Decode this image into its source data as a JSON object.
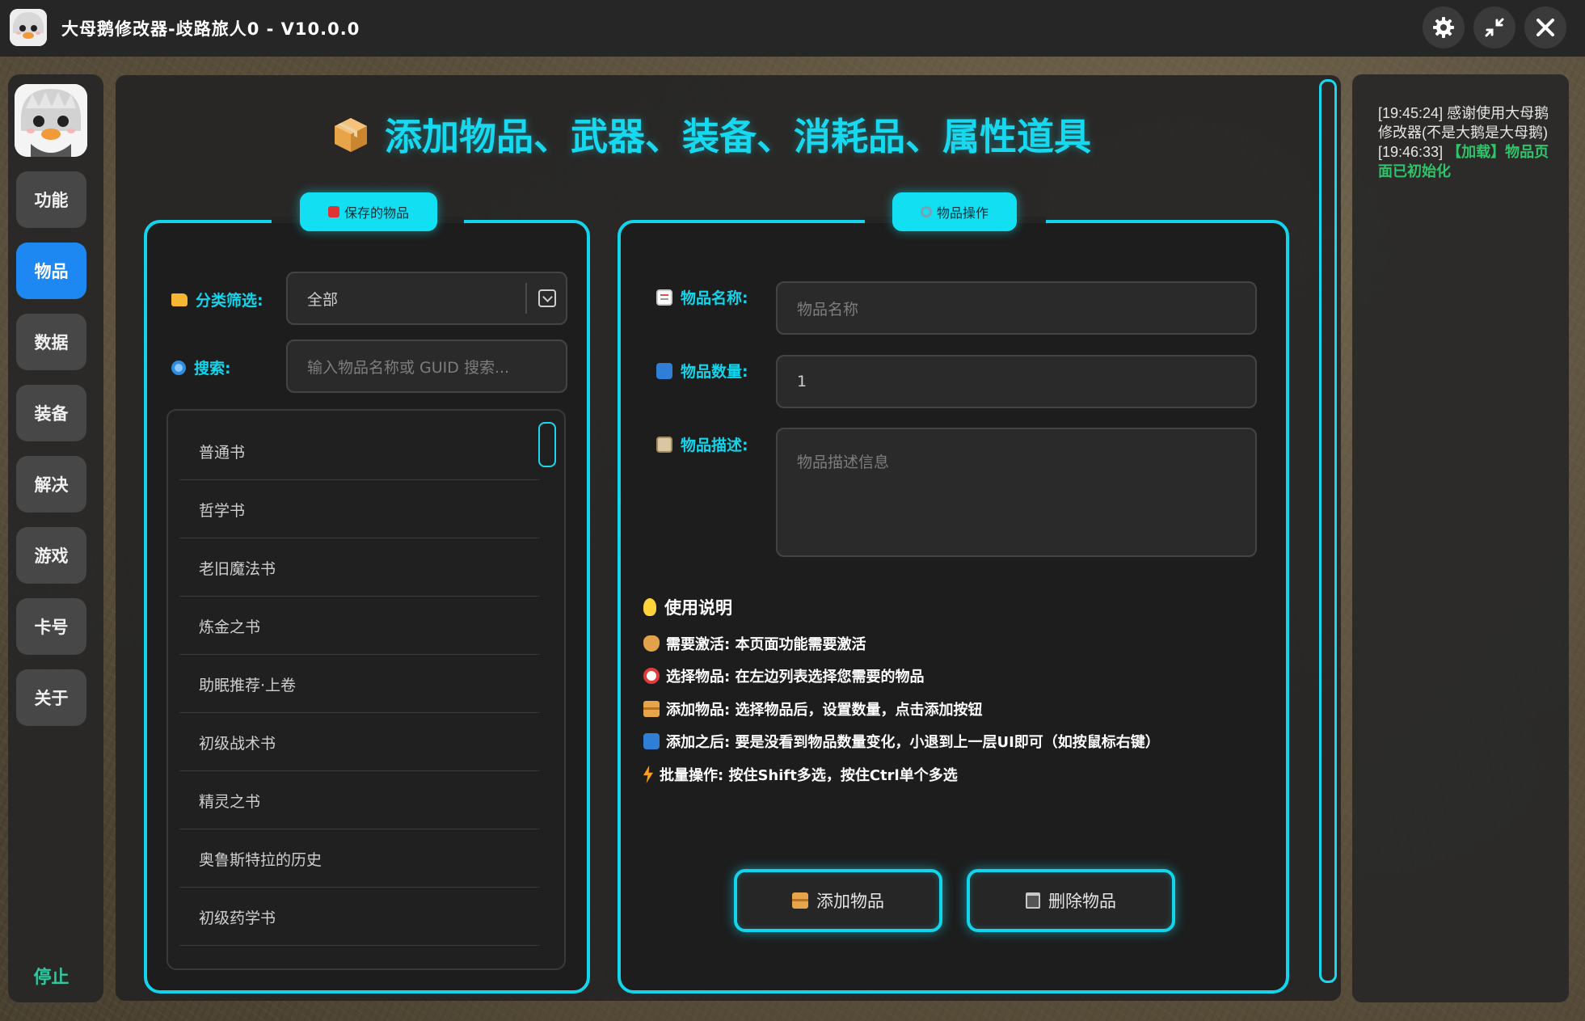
{
  "app": {
    "title": "大母鹅修改器-歧路旅人0 - V10.0.0",
    "window_buttons": {
      "settings_icon": "gear-icon",
      "minimize_icon": "collapse-arrows-icon",
      "close_icon": "close-icon"
    }
  },
  "sidebar": {
    "items": [
      {
        "label": "功能",
        "active": false
      },
      {
        "label": "物品",
        "active": true
      },
      {
        "label": "数据",
        "active": false
      },
      {
        "label": "装备",
        "active": false
      },
      {
        "label": "解决",
        "active": false
      },
      {
        "label": "游戏",
        "active": false
      },
      {
        "label": "卡号",
        "active": false
      },
      {
        "label": "关于",
        "active": false
      }
    ],
    "stop_label": "停止"
  },
  "main": {
    "title": "添加物品、武器、装备、消耗品、属性道具",
    "saved_items": {
      "tab_label": "保存的物品",
      "filter_label": "分类筛选:",
      "filter_value": "全部",
      "search_label": "搜索:",
      "search_placeholder": "输入物品名称或 GUID 搜索...",
      "items": [
        "普通书",
        "哲学书",
        "老旧魔法书",
        "炼金之书",
        "助眠推荐·上卷",
        "初级战术书",
        "精灵之书",
        "奥鲁斯特拉的历史",
        "初级药学书"
      ]
    },
    "operations": {
      "tab_label": "物品操作",
      "name_label": "物品名称:",
      "name_placeholder": "物品名称",
      "quantity_label": "物品数量:",
      "quantity_value": "1",
      "desc_label": "物品描述:",
      "desc_placeholder": "物品描述信息",
      "instructions_title": "使用说明",
      "instructions": [
        "需要激活: 本页面功能需要激活",
        "选择物品: 在左边列表选择您需要的物品",
        "添加物品: 选择物品后，设置数量，点击添加按钮",
        "添加之后: 要是没看到物品数量变化，小退到上一层UI即可（如按鼠标右键）",
        "批量操作: 按住Shift多选，按住Ctrl单个多选"
      ],
      "add_button": "添加物品",
      "delete_button": "删除物品"
    }
  },
  "log": {
    "entries": [
      {
        "time": "[19:45:24]",
        "text": "感谢使用大母鹅修改器(不是大鹅是大母鹅)"
      },
      {
        "time": "[19:46:33]",
        "text": "【加载】物品页面已初始化"
      }
    ]
  },
  "colors": {
    "accent": "#12d5ec",
    "active_nav": "#1e88f2",
    "log_success": "#2fc46a"
  }
}
